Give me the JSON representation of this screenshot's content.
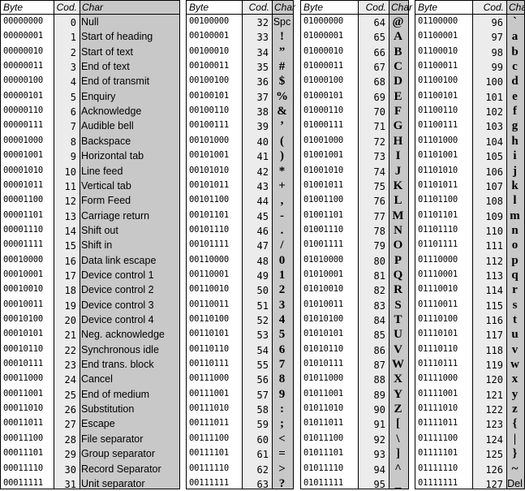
{
  "headers": {
    "byte": "Byte",
    "cod": "Cod.",
    "char": "Char"
  },
  "tables": [
    {
      "rows": [
        {
          "byte": "00000000",
          "cod": "0",
          "char": "Null"
        },
        {
          "byte": "00000001",
          "cod": "1",
          "char": "Start of heading"
        },
        {
          "byte": "00000010",
          "cod": "2",
          "char": "Start of text"
        },
        {
          "byte": "00000011",
          "cod": "3",
          "char": "End of text"
        },
        {
          "byte": "00000100",
          "cod": "4",
          "char": "End of transmit"
        },
        {
          "byte": "00000101",
          "cod": "5",
          "char": "Enquiry"
        },
        {
          "byte": "00000110",
          "cod": "6",
          "char": "Acknowledge"
        },
        {
          "byte": "00000111",
          "cod": "7",
          "char": "Audible bell"
        },
        {
          "byte": "00001000",
          "cod": "8",
          "char": "Backspace"
        },
        {
          "byte": "00001001",
          "cod": "9",
          "char": "Horizontal tab"
        },
        {
          "byte": "00001010",
          "cod": "10",
          "char": "Line feed"
        },
        {
          "byte": "00001011",
          "cod": "11",
          "char": "Vertical tab"
        },
        {
          "byte": "00001100",
          "cod": "12",
          "char": "Form Feed"
        },
        {
          "byte": "00001101",
          "cod": "13",
          "char": "Carriage return"
        },
        {
          "byte": "00001110",
          "cod": "14",
          "char": "Shift out"
        },
        {
          "byte": "00001111",
          "cod": "15",
          "char": "Shift in"
        },
        {
          "byte": "00010000",
          "cod": "16",
          "char": "Data link escape"
        },
        {
          "byte": "00010001",
          "cod": "17",
          "char": "Device control 1"
        },
        {
          "byte": "00010010",
          "cod": "18",
          "char": "Device control 2"
        },
        {
          "byte": "00010011",
          "cod": "19",
          "char": "Device control 3"
        },
        {
          "byte": "00010100",
          "cod": "20",
          "char": "Device control 4"
        },
        {
          "byte": "00010101",
          "cod": "21",
          "char": "Neg. acknowledge"
        },
        {
          "byte": "00010110",
          "cod": "22",
          "char": "Synchronous idle"
        },
        {
          "byte": "00010111",
          "cod": "23",
          "char": "End trans. block"
        },
        {
          "byte": "00011000",
          "cod": "24",
          "char": "Cancel"
        },
        {
          "byte": "00011001",
          "cod": "25",
          "char": "End of medium"
        },
        {
          "byte": "00011010",
          "cod": "26",
          "char": "Substitution"
        },
        {
          "byte": "00011011",
          "cod": "27",
          "char": "Escape"
        },
        {
          "byte": "00011100",
          "cod": "28",
          "char": "File separator"
        },
        {
          "byte": "00011101",
          "cod": "29",
          "char": "Group separator"
        },
        {
          "byte": "00011110",
          "cod": "30",
          "char": "Record Separator"
        },
        {
          "byte": "00011111",
          "cod": "31",
          "char": "Unit separator"
        }
      ]
    },
    {
      "rows": [
        {
          "byte": "00100000",
          "cod": "32",
          "char": "Spc"
        },
        {
          "byte": "00100001",
          "cod": "33",
          "char": "!"
        },
        {
          "byte": "00100010",
          "cod": "34",
          "char": "”"
        },
        {
          "byte": "00100011",
          "cod": "35",
          "char": "#"
        },
        {
          "byte": "00100100",
          "cod": "36",
          "char": "$"
        },
        {
          "byte": "00100101",
          "cod": "37",
          "char": "%"
        },
        {
          "byte": "00100110",
          "cod": "38",
          "char": "&"
        },
        {
          "byte": "00100111",
          "cod": "39",
          "char": "’"
        },
        {
          "byte": "00101000",
          "cod": "40",
          "char": "("
        },
        {
          "byte": "00101001",
          "cod": "41",
          "char": ")"
        },
        {
          "byte": "00101010",
          "cod": "42",
          "char": "*"
        },
        {
          "byte": "00101011",
          "cod": "43",
          "char": "+"
        },
        {
          "byte": "00101100",
          "cod": "44",
          "char": ","
        },
        {
          "byte": "00101101",
          "cod": "45",
          "char": "-"
        },
        {
          "byte": "00101110",
          "cod": "46",
          "char": "."
        },
        {
          "byte": "00101111",
          "cod": "47",
          "char": "/"
        },
        {
          "byte": "00110000",
          "cod": "48",
          "char": "0"
        },
        {
          "byte": "00110001",
          "cod": "49",
          "char": "1"
        },
        {
          "byte": "00110010",
          "cod": "50",
          "char": "2"
        },
        {
          "byte": "00110011",
          "cod": "51",
          "char": "3"
        },
        {
          "byte": "00110100",
          "cod": "52",
          "char": "4"
        },
        {
          "byte": "00110101",
          "cod": "53",
          "char": "5"
        },
        {
          "byte": "00110110",
          "cod": "54",
          "char": "6"
        },
        {
          "byte": "00110111",
          "cod": "55",
          "char": "7"
        },
        {
          "byte": "00111000",
          "cod": "56",
          "char": "8"
        },
        {
          "byte": "00111001",
          "cod": "57",
          "char": "9"
        },
        {
          "byte": "00111010",
          "cod": "58",
          "char": ":"
        },
        {
          "byte": "00111011",
          "cod": "59",
          "char": ";"
        },
        {
          "byte": "00111100",
          "cod": "60",
          "char": "<"
        },
        {
          "byte": "00111101",
          "cod": "61",
          "char": "="
        },
        {
          "byte": "00111110",
          "cod": "62",
          "char": ">"
        },
        {
          "byte": "00111111",
          "cod": "63",
          "char": "?"
        }
      ]
    },
    {
      "rows": [
        {
          "byte": "01000000",
          "cod": "64",
          "char": "@"
        },
        {
          "byte": "01000001",
          "cod": "65",
          "char": "A"
        },
        {
          "byte": "01000010",
          "cod": "66",
          "char": "B"
        },
        {
          "byte": "01000011",
          "cod": "67",
          "char": "C"
        },
        {
          "byte": "01000100",
          "cod": "68",
          "char": "D"
        },
        {
          "byte": "01000101",
          "cod": "69",
          "char": "E"
        },
        {
          "byte": "01000110",
          "cod": "70",
          "char": "F"
        },
        {
          "byte": "01000111",
          "cod": "71",
          "char": "G"
        },
        {
          "byte": "01001000",
          "cod": "72",
          "char": "H"
        },
        {
          "byte": "01001001",
          "cod": "73",
          "char": "I"
        },
        {
          "byte": "01001010",
          "cod": "74",
          "char": "J"
        },
        {
          "byte": "01001011",
          "cod": "75",
          "char": "K"
        },
        {
          "byte": "01001100",
          "cod": "76",
          "char": "L"
        },
        {
          "byte": "01001101",
          "cod": "77",
          "char": "M"
        },
        {
          "byte": "01001110",
          "cod": "78",
          "char": "N"
        },
        {
          "byte": "01001111",
          "cod": "79",
          "char": "O"
        },
        {
          "byte": "01010000",
          "cod": "80",
          "char": "P"
        },
        {
          "byte": "01010001",
          "cod": "81",
          "char": "Q"
        },
        {
          "byte": "01010010",
          "cod": "82",
          "char": "R"
        },
        {
          "byte": "01010011",
          "cod": "83",
          "char": "S"
        },
        {
          "byte": "01010100",
          "cod": "84",
          "char": "T"
        },
        {
          "byte": "01010101",
          "cod": "85",
          "char": "U"
        },
        {
          "byte": "01010110",
          "cod": "86",
          "char": "V"
        },
        {
          "byte": "01010111",
          "cod": "87",
          "char": "W"
        },
        {
          "byte": "01011000",
          "cod": "88",
          "char": "X"
        },
        {
          "byte": "01011001",
          "cod": "89",
          "char": "Y"
        },
        {
          "byte": "01011010",
          "cod": "90",
          "char": "Z"
        },
        {
          "byte": "01011011",
          "cod": "91",
          "char": "["
        },
        {
          "byte": "01011100",
          "cod": "92",
          "char": "\\"
        },
        {
          "byte": "01011101",
          "cod": "93",
          "char": "]"
        },
        {
          "byte": "01011110",
          "cod": "94",
          "char": "^"
        },
        {
          "byte": "01011111",
          "cod": "95",
          "char": "_"
        }
      ]
    },
    {
      "rows": [
        {
          "byte": "01100000",
          "cod": "96",
          "char": "`"
        },
        {
          "byte": "01100001",
          "cod": "97",
          "char": "a"
        },
        {
          "byte": "01100010",
          "cod": "98",
          "char": "b"
        },
        {
          "byte": "01100011",
          "cod": "99",
          "char": "c"
        },
        {
          "byte": "01100100",
          "cod": "100",
          "char": "d"
        },
        {
          "byte": "01100101",
          "cod": "101",
          "char": "e"
        },
        {
          "byte": "01100110",
          "cod": "102",
          "char": "f"
        },
        {
          "byte": "01100111",
          "cod": "103",
          "char": "g"
        },
        {
          "byte": "01101000",
          "cod": "104",
          "char": "h"
        },
        {
          "byte": "01101001",
          "cod": "105",
          "char": "i"
        },
        {
          "byte": "01101010",
          "cod": "106",
          "char": "j"
        },
        {
          "byte": "01101011",
          "cod": "107",
          "char": "k"
        },
        {
          "byte": "01101100",
          "cod": "108",
          "char": "l"
        },
        {
          "byte": "01101101",
          "cod": "109",
          "char": "m"
        },
        {
          "byte": "01101110",
          "cod": "110",
          "char": "n"
        },
        {
          "byte": "01101111",
          "cod": "111",
          "char": "o"
        },
        {
          "byte": "01110000",
          "cod": "112",
          "char": "p"
        },
        {
          "byte": "01110001",
          "cod": "113",
          "char": "q"
        },
        {
          "byte": "01110010",
          "cod": "114",
          "char": "r"
        },
        {
          "byte": "01110011",
          "cod": "115",
          "char": "s"
        },
        {
          "byte": "01110100",
          "cod": "116",
          "char": "t"
        },
        {
          "byte": "01110101",
          "cod": "117",
          "char": "u"
        },
        {
          "byte": "01110110",
          "cod": "118",
          "char": "v"
        },
        {
          "byte": "01110111",
          "cod": "119",
          "char": "w"
        },
        {
          "byte": "01111000",
          "cod": "120",
          "char": "x"
        },
        {
          "byte": "01111001",
          "cod": "121",
          "char": "y"
        },
        {
          "byte": "01111010",
          "cod": "122",
          "char": "z"
        },
        {
          "byte": "01111011",
          "cod": "123",
          "char": "{"
        },
        {
          "byte": "01111100",
          "cod": "124",
          "char": "|"
        },
        {
          "byte": "01111101",
          "cod": "125",
          "char": "}"
        },
        {
          "byte": "01111110",
          "cod": "126",
          "char": "~"
        },
        {
          "byte": "01111111",
          "cod": "127",
          "char": "Del"
        }
      ]
    }
  ]
}
